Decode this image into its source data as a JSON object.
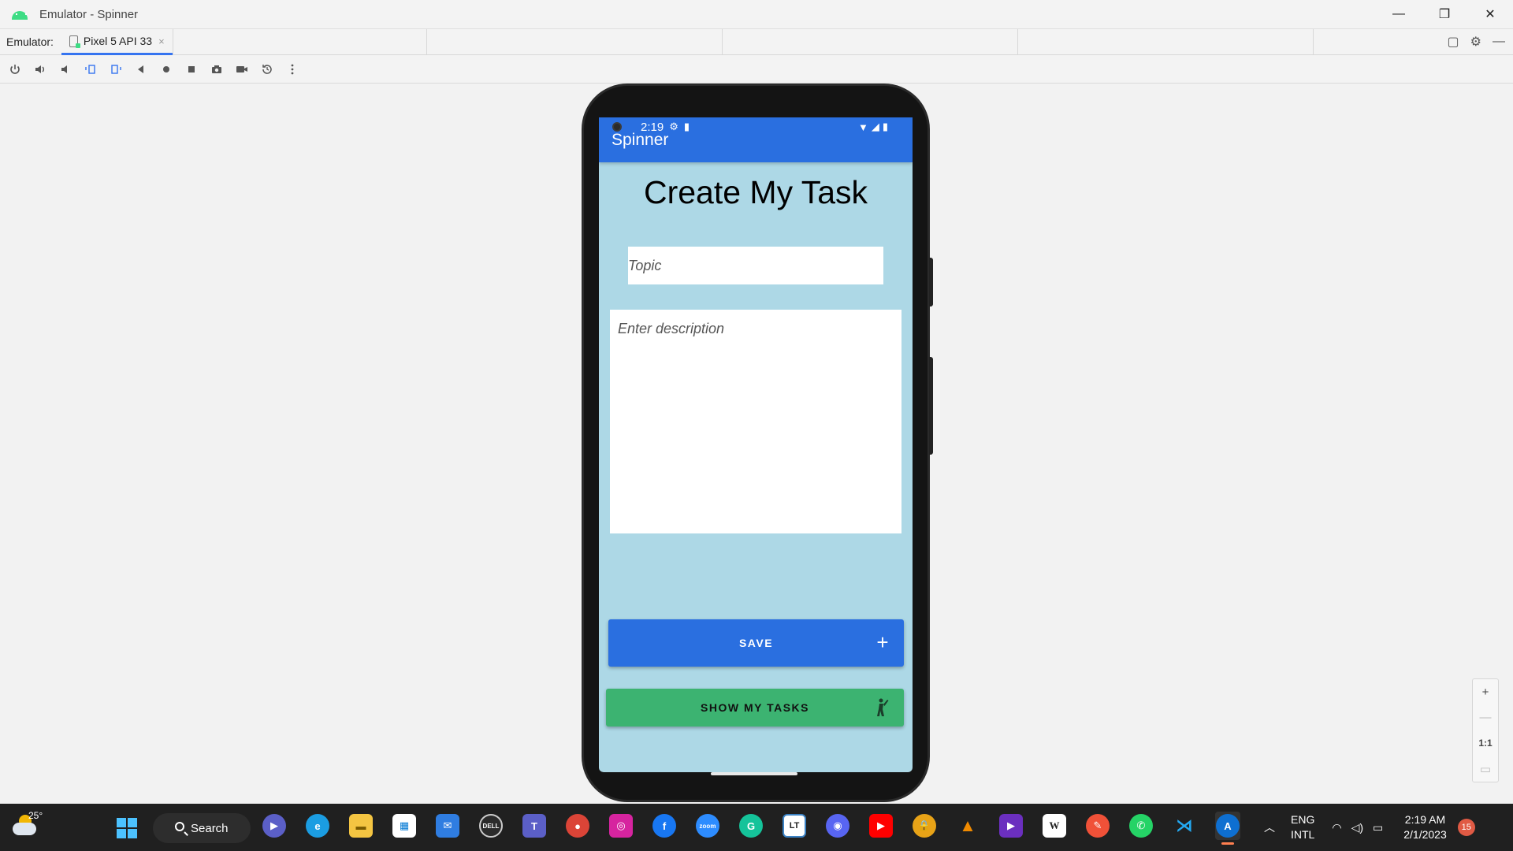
{
  "window": {
    "title": "Emulator - Spinner",
    "minimize": "—",
    "maximize": "❐",
    "close": "✕"
  },
  "tabs": {
    "label": "Emulator:",
    "active_tab": "Pixel 5 API 33",
    "tab_close": "×"
  },
  "toolbar": {
    "icons": [
      "power-icon",
      "volume-up-icon",
      "volume-down-icon",
      "rotate-left-icon",
      "rotate-right-icon",
      "back-icon",
      "home-icon",
      "overview-icon",
      "screenshot-icon",
      "screen-record-icon",
      "snapshot-icon",
      "more-icon"
    ]
  },
  "device": {
    "status_time": "2:19"
  },
  "app": {
    "appbar_title": "Spinner",
    "page_title": "Create My Task",
    "topic_placeholder": "Topic",
    "description_placeholder": "Enter description",
    "save_label": "SAVE",
    "show_tasks_label": "SHOW MY TASKS",
    "colors": {
      "primary": "#2a6fe0",
      "background": "#add8e6",
      "secondary": "#3cb371"
    }
  },
  "zoom": {
    "zoom_in": "+",
    "zoom_out": "—",
    "actual_size": "1:1"
  },
  "taskbar": {
    "weather_temp": "25°",
    "search_label": "Search",
    "language_line1": "ENG",
    "language_line2": "INTL",
    "clock_time": "2:19 AM",
    "clock_date": "2/1/2023",
    "notification_count": "15"
  }
}
